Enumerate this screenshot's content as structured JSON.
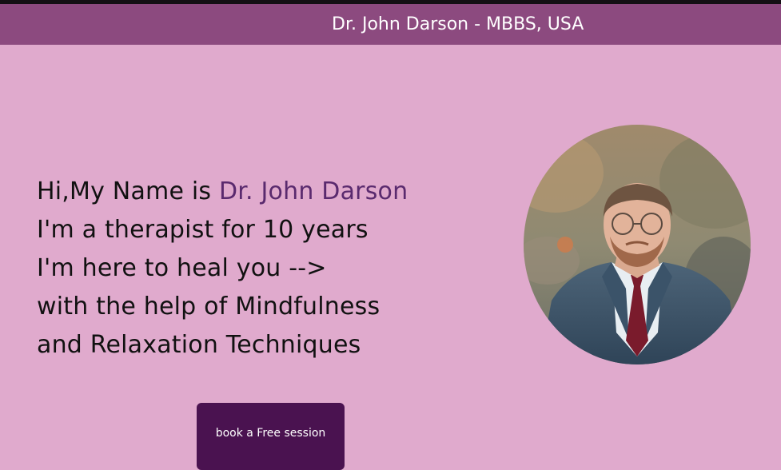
{
  "header": {
    "title": "Dr. John Darson - MBBS, USA"
  },
  "intro": {
    "greeting_prefix": "Hi,My Name is ",
    "name": "Dr. John Darson",
    "line2": "I'm a therapist for 10 years",
    "line3": "I'm here to heal you -->",
    "line4": "with the help of Mindfulness",
    "line5": "and Relaxation Techniques"
  },
  "cta": {
    "label": "book a Free session"
  },
  "colors": {
    "background": "#e0aacd",
    "header": "#8c4a7f",
    "accent_text": "#5a2a6e",
    "button": "#4a1250"
  }
}
